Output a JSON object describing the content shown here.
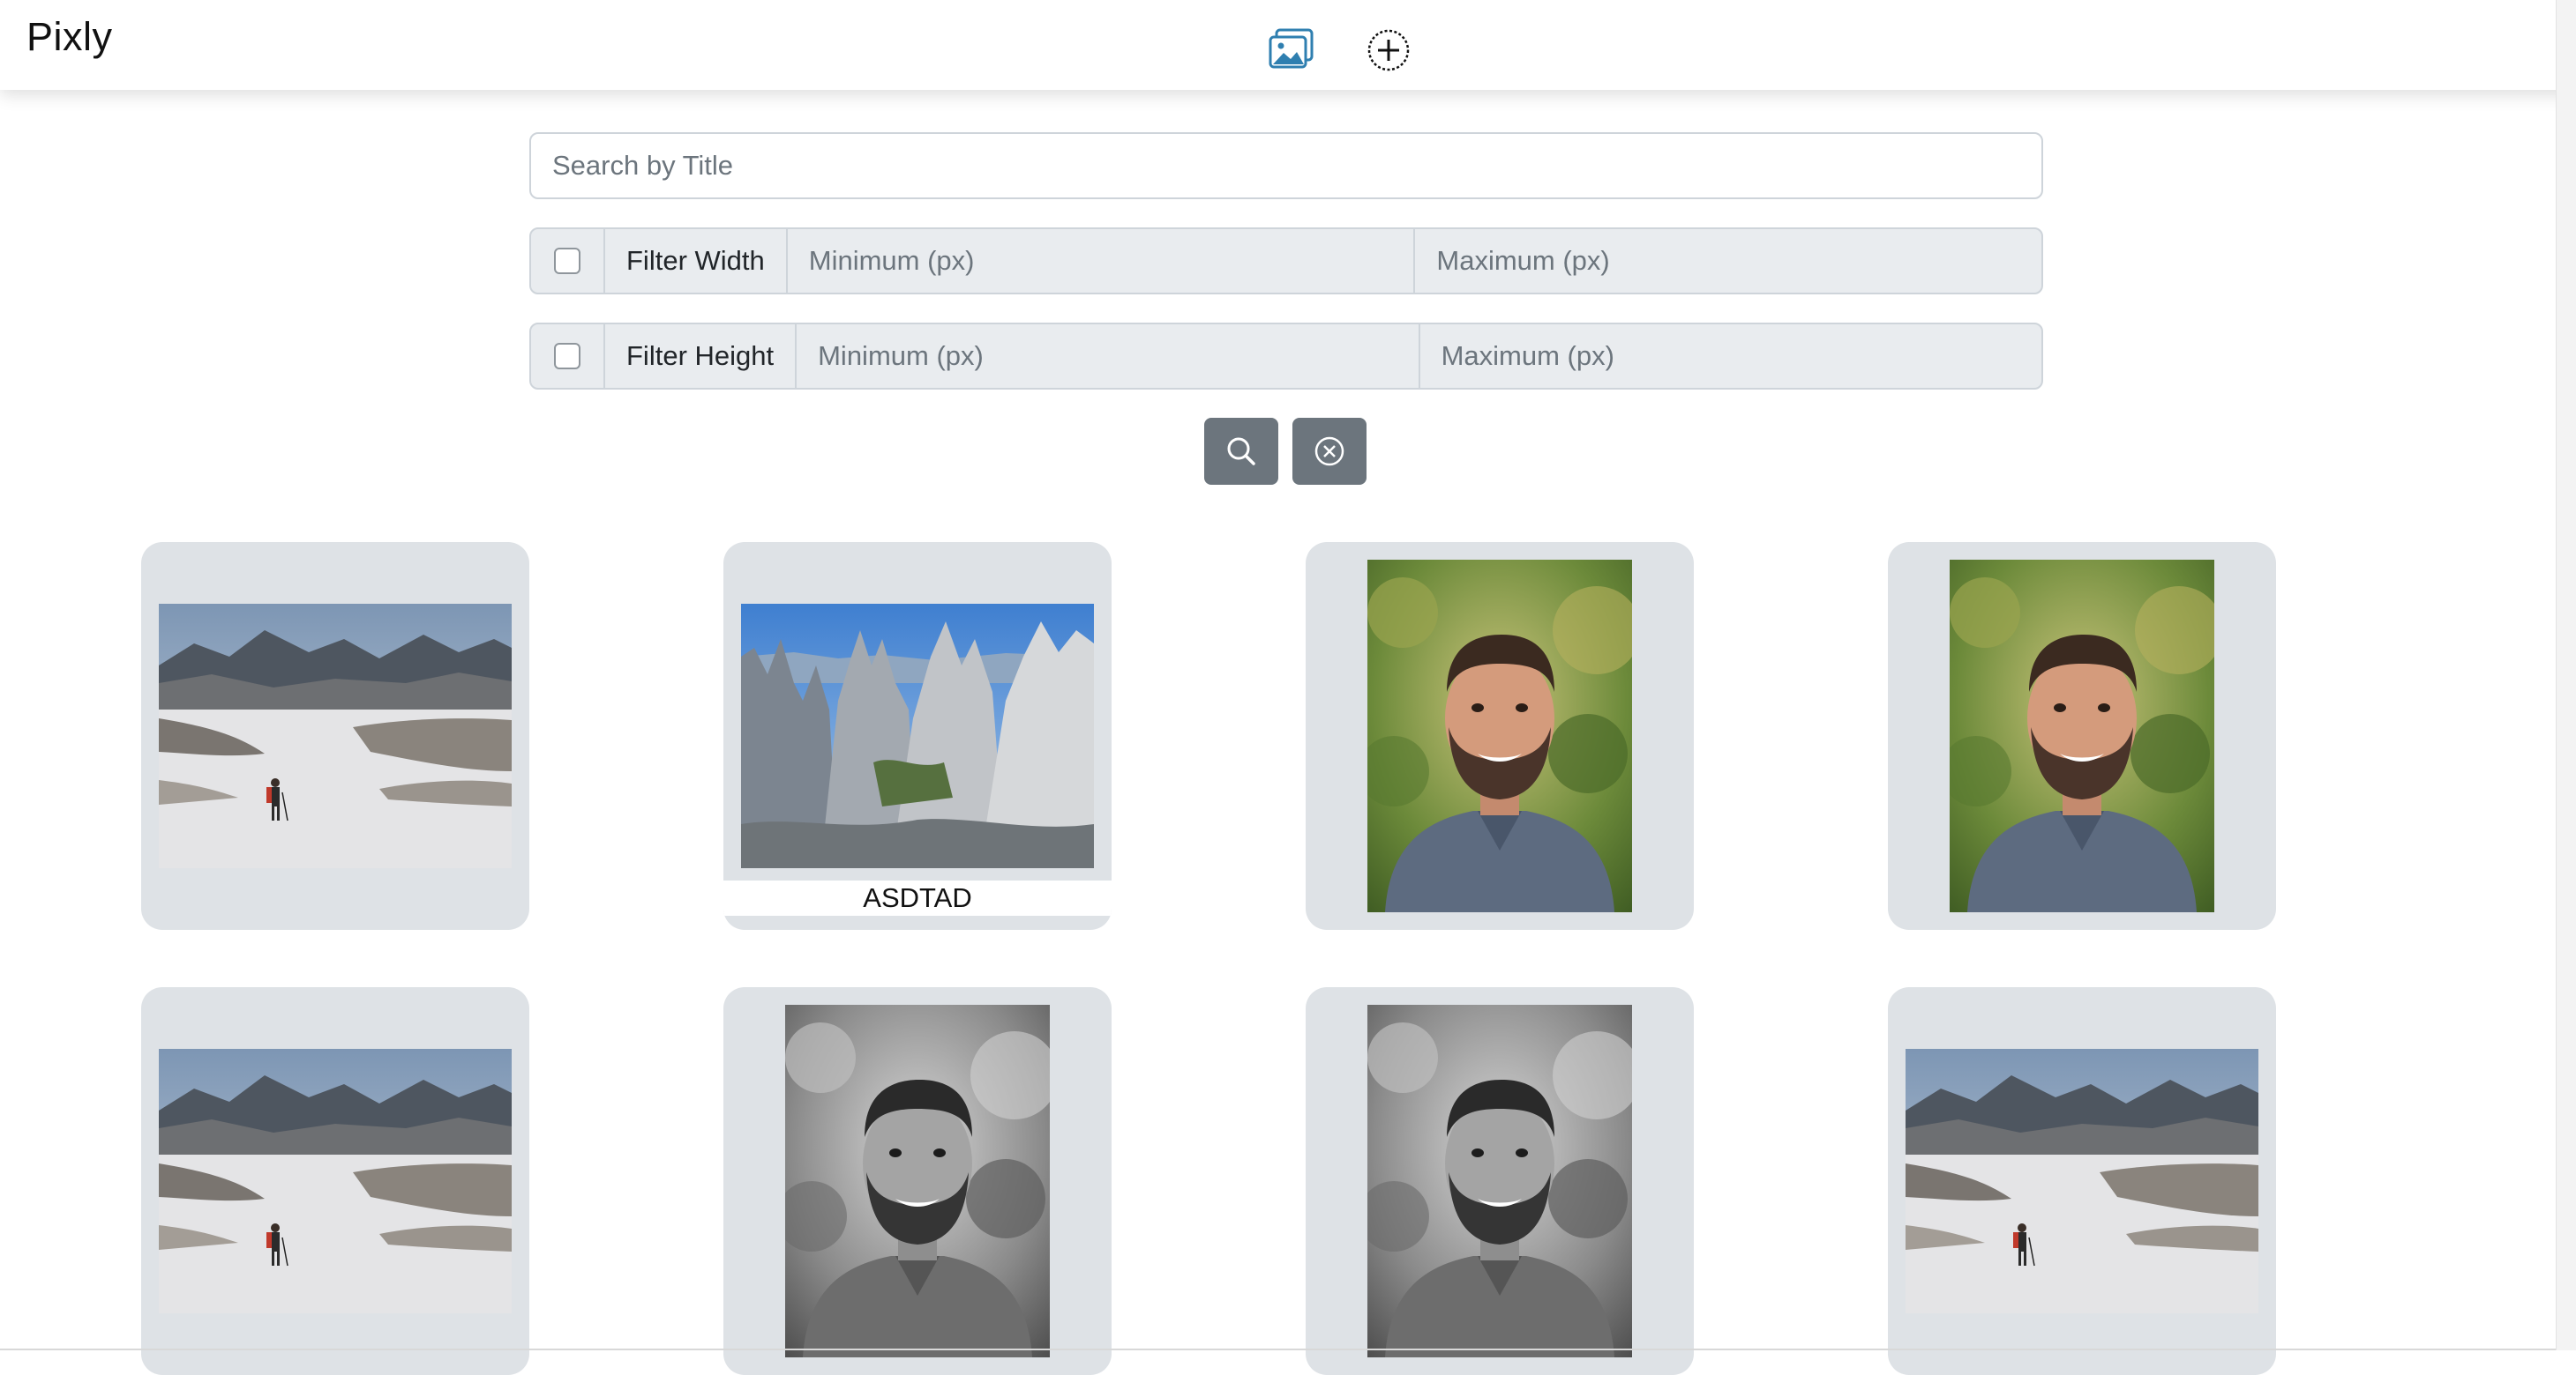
{
  "navbar": {
    "brand": "Pixly",
    "gallery_icon": "images-icon",
    "add_icon": "plus-circle-icon"
  },
  "search": {
    "placeholder": "Search by Title"
  },
  "filters": {
    "width": {
      "label": "Filter Width",
      "min_placeholder": "Minimum (px)",
      "max_placeholder": "Maximum (px)",
      "checked": false
    },
    "height": {
      "label": "Filter Height",
      "min_placeholder": "Minimum (px)",
      "max_placeholder": "Maximum (px)",
      "checked": false
    }
  },
  "actions": {
    "search_icon": "search-icon",
    "clear_icon": "x-circle-icon"
  },
  "gallery": {
    "cards": [
      {
        "photo": "mountain-hiker"
      },
      {
        "photo": "rock-spires",
        "title": "ASDTAD"
      },
      {
        "photo": "portrait-color"
      },
      {
        "photo": "portrait-color"
      },
      {
        "photo": "mountain-hiker"
      },
      {
        "photo": "portrait-bw"
      },
      {
        "photo": "portrait-bw"
      },
      {
        "photo": "mountain-hiker"
      }
    ]
  },
  "colors": {
    "card_bg": "#dee2e6",
    "button_bg": "#6c757d",
    "icon_blue": "#2f7fb0"
  }
}
